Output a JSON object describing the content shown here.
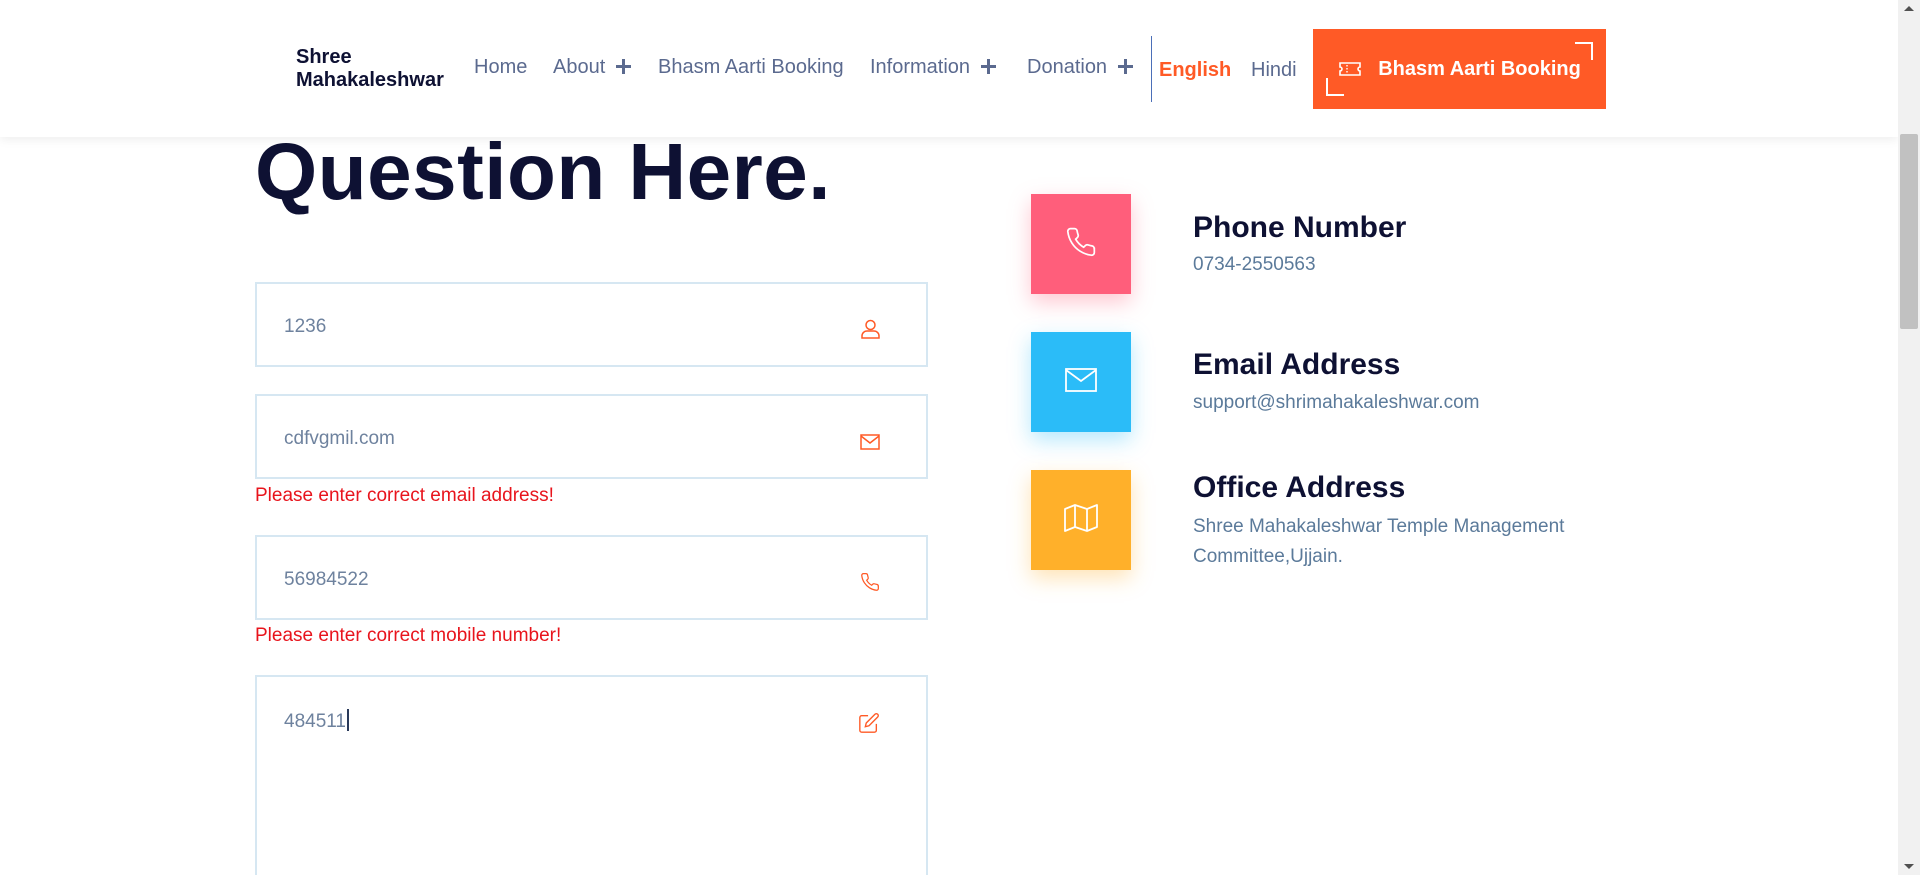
{
  "header": {
    "logo": "Shree\nMahakaleshwar",
    "logo_line1": "Shree",
    "logo_line2": "Mahakaleshwar",
    "nav": [
      {
        "label": "Home",
        "has_plus": false
      },
      {
        "label": "About",
        "has_plus": true
      },
      {
        "label": "Bhasm Aarti Booking",
        "has_plus": false
      },
      {
        "label": "Information",
        "has_plus": true
      },
      {
        "label": "Donation",
        "has_plus": true
      }
    ],
    "lang_english": "English",
    "lang_hindi": "Hindi",
    "cta_label": "Bhasm Aarti Booking",
    "accent_color": "#ff5a26"
  },
  "form": {
    "heading": "Question Here.",
    "name_value": "1236",
    "email_value": "cdfvgmil.com",
    "email_error": "Please enter correct email address!",
    "phone_value": "56984522",
    "phone_error": "Please enter correct mobile number!",
    "message_value": "484511",
    "icons": [
      "user-icon",
      "envelope-icon",
      "phone-icon",
      "edit-icon"
    ]
  },
  "contact": [
    {
      "title": "Phone Number",
      "text": "0734-2550563",
      "color": "#ff5e7b",
      "icon": "phone-icon"
    },
    {
      "title": "Email Address",
      "text": "support@shrimahakaleshwar.com",
      "color": "#2bbcf8",
      "icon": "envelope-icon"
    },
    {
      "title": "Office Address",
      "text_line1": "Shree Mahakaleshwar Temple Management",
      "text_line2": "Committee,Ujjain.",
      "color": "#ffb02a",
      "icon": "map-icon"
    }
  ]
}
